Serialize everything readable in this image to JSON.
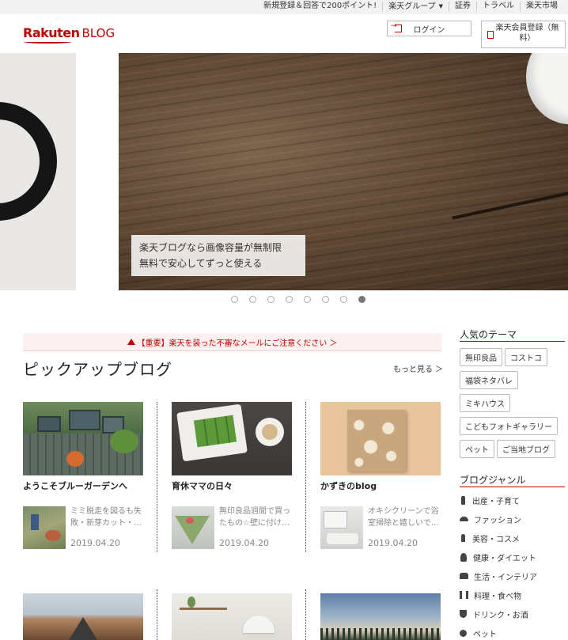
{
  "topbar": {
    "links": [
      "新規登録＆回答で200ポイント!",
      "楽天グループ",
      "証券",
      "トラベル",
      "楽天市場"
    ]
  },
  "header": {
    "logo_main": "Rakuten",
    "logo_sub": "BLOG",
    "login_label": "ログイン",
    "register_label": "楽天会員登録（無料）"
  },
  "hero": {
    "caption_line1": "楽天ブログなら画像容量が無制限",
    "caption_line2": "無料で安心してずっと使える",
    "slide_count": 8,
    "active_slide": 8
  },
  "alert": {
    "text": "【重要】楽天を装った不審なメールにご注意ください ＞"
  },
  "pickup": {
    "title": "ピックアップブログ",
    "more_label": "もっと見る ＞",
    "blogs": [
      {
        "name": "ようこそブルーガーデンへ",
        "entry_title": "ミミ脱走を図るも失敗・新芽カット・…",
        "entry_date": "2019.04.20"
      },
      {
        "name": "育休ママの日々",
        "entry_title": "無印良品週間で買ったもの☆壁に付け…",
        "entry_date": "2019.04.20"
      },
      {
        "name": "かずきのblog",
        "entry_title": "オキシクリーンで浴室掃除と嬉しいで…",
        "entry_date": "2019.04.20"
      }
    ]
  },
  "sidebar": {
    "themes_title": "人気のテーマ",
    "themes": [
      "無印良品",
      "コストコ",
      "福袋ネタバレ",
      "ミキハウス",
      "こどもフォトギャラリー",
      "ペット",
      "ご当地ブログ"
    ],
    "genres_title": "ブログジャンル",
    "genres": [
      {
        "label": "出産・子育て",
        "icon": "baby-bottle-icon"
      },
      {
        "label": "ファッション",
        "icon": "hat-icon"
      },
      {
        "label": "美容・コスメ",
        "icon": "lipstick-icon"
      },
      {
        "label": "健康・ダイエット",
        "icon": "running-icon"
      },
      {
        "label": "生活・インテリア",
        "icon": "sofa-icon"
      },
      {
        "label": "料理・食べ物",
        "icon": "fork-knife-icon"
      },
      {
        "label": "ドリンク・お酒",
        "icon": "wine-glass-icon"
      },
      {
        "label": "ペット",
        "icon": "paw-icon"
      }
    ]
  },
  "colors": {
    "brand": "#bf0000",
    "alert_bg": "#fdf0f0"
  }
}
